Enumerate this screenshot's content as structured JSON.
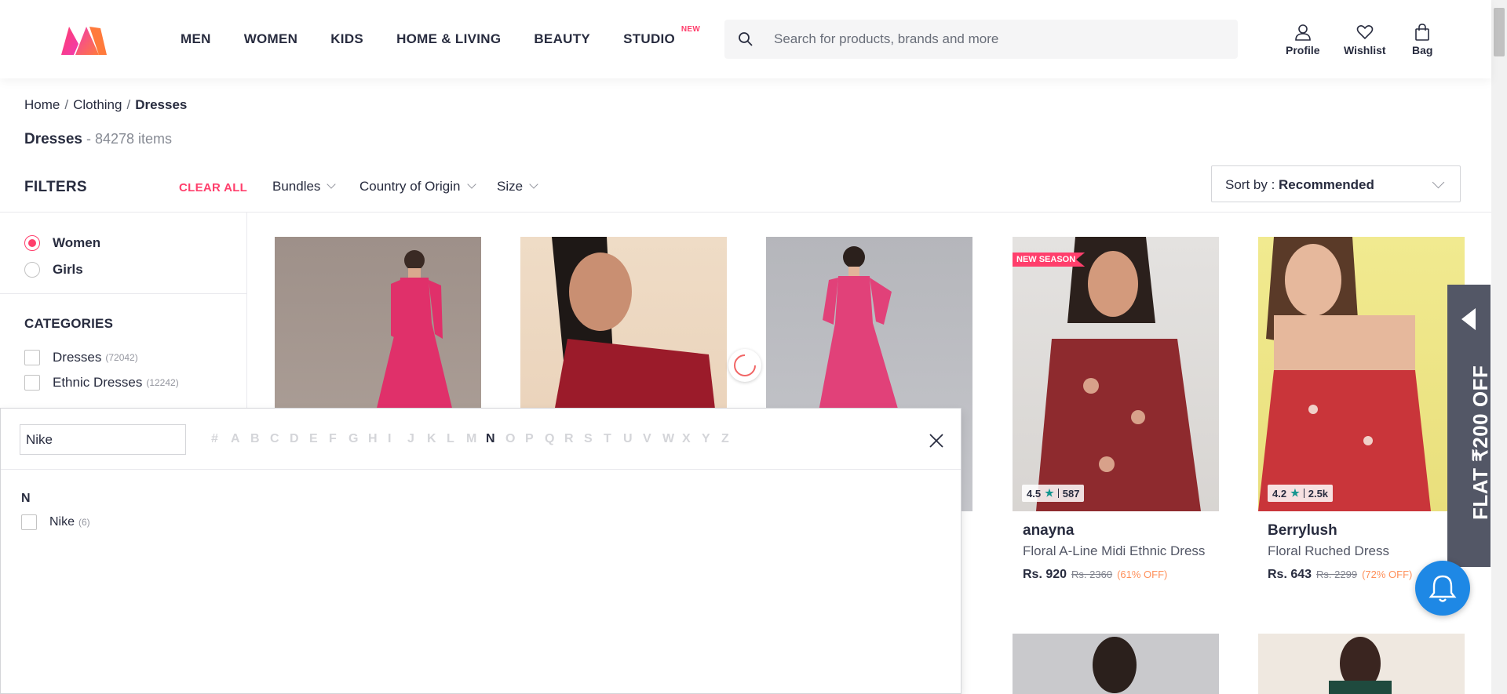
{
  "header": {
    "nav": [
      "MEN",
      "WOMEN",
      "KIDS",
      "HOME & LIVING",
      "BEAUTY",
      "STUDIO"
    ],
    "studio_badge": "NEW",
    "search_placeholder": "Search for products, brands and more",
    "actions": {
      "profile": "Profile",
      "wishlist": "Wishlist",
      "bag": "Bag"
    }
  },
  "breadcrumb": {
    "home": "Home",
    "clothing": "Clothing",
    "current": "Dresses"
  },
  "page": {
    "title": "Dresses",
    "count": " - 84278 items"
  },
  "filters": {
    "label": "FILTERS",
    "clear_all": "CLEAR ALL",
    "chips": [
      "Bundles",
      "Country of Origin",
      "Size"
    ],
    "sort_prefix": "Sort by : ",
    "sort_value": "Recommended"
  },
  "sidebar": {
    "gender": [
      {
        "label": "Women",
        "selected": true
      },
      {
        "label": "Girls",
        "selected": false
      }
    ],
    "categories_label": "CATEGORIES",
    "categories": [
      {
        "label": "Dresses",
        "count": "(72042)"
      },
      {
        "label": "Ethnic Dresses",
        "count": "(12242)"
      }
    ]
  },
  "products": [
    {
      "badge": "NEW SEASON",
      "rating": "4.5",
      "rating_count": "587",
      "brand": "anayna",
      "name": "Floral A-Line Midi Ethnic Dress",
      "price": "Rs. 920",
      "mrp": "Rs. 2360",
      "discount": "(61% OFF)"
    },
    {
      "rating": "4.2",
      "rating_count": "2.5k",
      "brand": "Berrylush",
      "name": "Floral Ruched Dress",
      "price": "Rs. 643",
      "mrp": "Rs. 2299",
      "discount": "(72% OFF)"
    }
  ],
  "promo": {
    "text": "FLAT ₹200 OFF"
  },
  "brand_search": {
    "query": "Nike",
    "alphabet": [
      "#",
      "A",
      "B",
      "C",
      "D",
      "E",
      "F",
      "G",
      "H",
      "I",
      "J",
      "K",
      "L",
      "M",
      "N",
      "O",
      "P",
      "Q",
      "R",
      "S",
      "T",
      "U",
      "V",
      "W",
      "X",
      "Y",
      "Z"
    ],
    "active_letter": "N",
    "group": "N",
    "results": [
      {
        "label": "Nike",
        "count": "(6)"
      }
    ]
  },
  "colors": {
    "accent": "#ff3f6c",
    "teal": "#14958f",
    "bell": "#1e88e5"
  }
}
